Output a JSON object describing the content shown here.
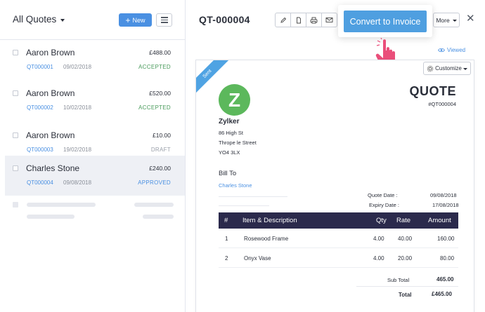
{
  "list": {
    "title": "All Quotes",
    "new_label": "New",
    "items": [
      {
        "name": "Aaron Brown",
        "amount": "£488.00",
        "number": "QT000001",
        "date": "09/02/2018",
        "status": "ACCEPTED"
      },
      {
        "name": "Aaron Brown",
        "amount": "£520.00",
        "number": "QT000002",
        "date": "10/02/2018",
        "status": "ACCEPTED"
      },
      {
        "name": "Aaron Brown",
        "amount": "£10.00",
        "number": "QT000003",
        "date": "19/02/2018",
        "status": "DRAFT"
      },
      {
        "name": "Charles Stone",
        "amount": "£240.00",
        "number": "QT000004",
        "date": "09/08/2018",
        "status": "APPROVED"
      }
    ]
  },
  "header": {
    "doc_id": "QT-000004",
    "more_label": "More",
    "convert_label": "Convert to Invoice",
    "close_icon": "close-icon"
  },
  "status_viewed": "Viewed",
  "document": {
    "ribbon": "Sent",
    "customize_label": "Customize",
    "logo_letter": "Z",
    "org_name": "Zylker",
    "address": [
      "86 High St",
      "Thrope le Street",
      "YO4 3LX"
    ],
    "title": "QUOTE",
    "number": "#QT000004",
    "bill_to_label": "Bill To",
    "bill_to_name": "Charles Stone",
    "quote_date_label": "Quote Date :",
    "quote_date": "09/08/2018",
    "expiry_date_label": "Expiry Date :",
    "expiry_date": "17/08/2018",
    "columns": {
      "num": "#",
      "item": "Item & Description",
      "qty": "Qty",
      "rate": "Rate",
      "amount": "Amount"
    },
    "rows": [
      {
        "num": "1",
        "item": "Rosewood Frame",
        "qty": "4.00",
        "rate": "40.00",
        "amount": "160.00"
      },
      {
        "num": "2",
        "item": "Onyx Vase",
        "qty": "4.00",
        "rate": "20.00",
        "amount": "80.00"
      }
    ],
    "subtotal_label": "Sub Total",
    "subtotal": "465.00",
    "total_label": "Total",
    "total": "£465.00"
  },
  "colors": {
    "accent": "#4a90e2",
    "table_header": "#2b2a4c",
    "logo": "#5cb85c",
    "accepted": "#4a9b5c",
    "hand": "#e9507a"
  }
}
